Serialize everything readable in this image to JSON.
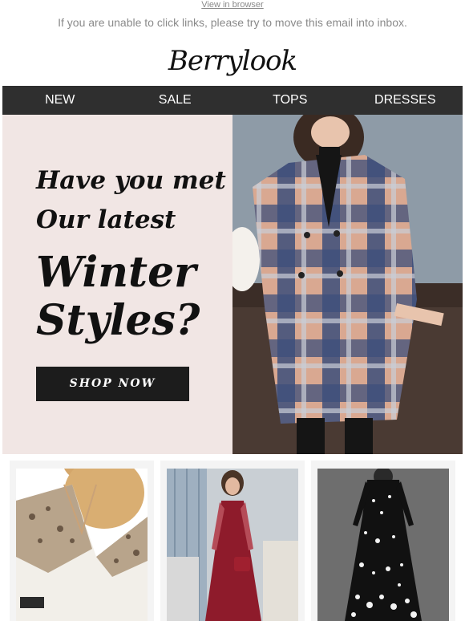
{
  "header": {
    "view_in_browser": "View in browser",
    "notice": "If you are unable to click links, please try to move this email into inbox.",
    "logo": "Berrylook"
  },
  "nav": {
    "items": [
      {
        "label": "NEW"
      },
      {
        "label": "SALE"
      },
      {
        "label": "TOPS"
      },
      {
        "label": "DRESSES"
      }
    ]
  },
  "hero": {
    "line1": "Have you met",
    "line2": "Our latest",
    "line3": "Winter",
    "line4": "Styles?",
    "cta": "SHOP NOW",
    "image_icon": "plaid-coat-model-image"
  },
  "products": [
    {
      "image_icon": "leopard-sweater-image"
    },
    {
      "image_icon": "red-lace-dress-image"
    },
    {
      "image_icon": "polka-dot-maxi-dress-image"
    }
  ],
  "colors": {
    "nav_bg": "#2f2f2f",
    "hero_bg": "#f1e6e4",
    "button_bg": "#1c1c1c"
  }
}
